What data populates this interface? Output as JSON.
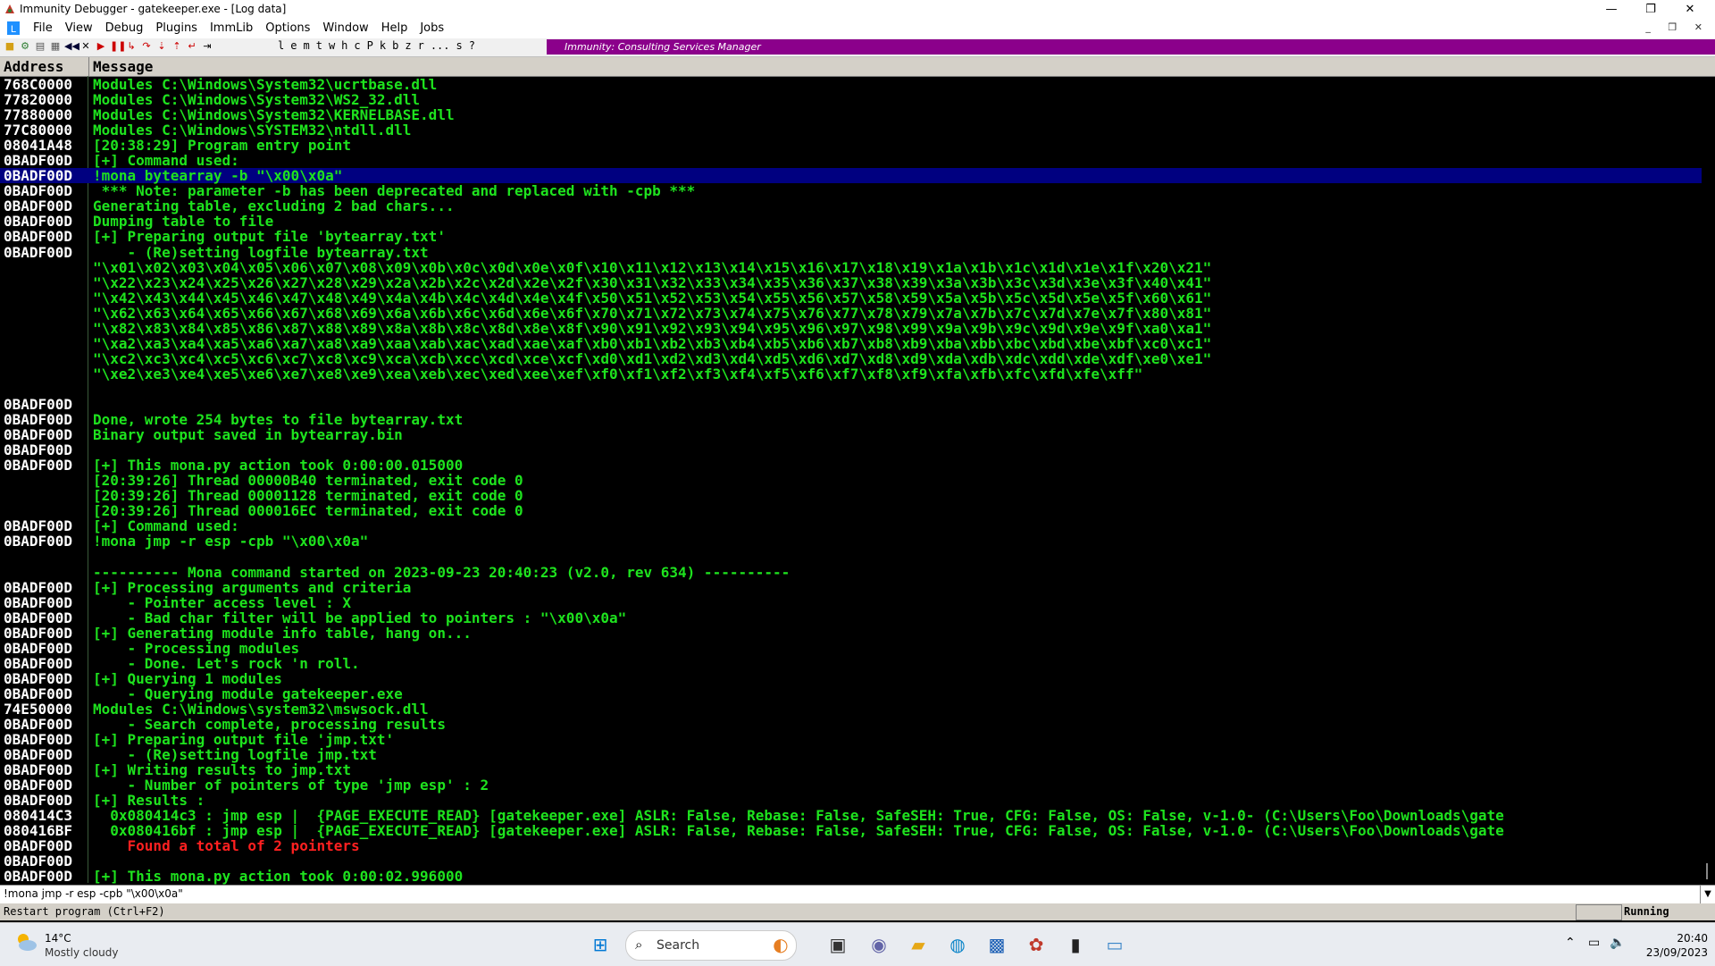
{
  "window": {
    "title": "Immunity Debugger - gatekeeper.exe - [Log data]",
    "controls": {
      "minimize": "—",
      "maximize": "❐",
      "close": "✕"
    }
  },
  "menu": [
    "File",
    "View",
    "Debug",
    "Plugins",
    "ImmLib",
    "Options",
    "Window",
    "Help",
    "Jobs"
  ],
  "toolbar": {
    "letters": [
      "l",
      "e",
      "m",
      "t",
      "w",
      "h",
      "c",
      "P",
      "k",
      "b",
      "z",
      "r",
      "...",
      "s",
      "?"
    ],
    "banner": "Immunity: Consulting Services Manager"
  },
  "log": {
    "headers": {
      "address": "Address",
      "message": "Message"
    },
    "rows": [
      {
        "a": "768C0000",
        "m": "Modules C:\\Windows\\System32\\ucrtbase.dll"
      },
      {
        "a": "77820000",
        "m": "Modules C:\\Windows\\System32\\WS2_32.dll"
      },
      {
        "a": "77880000",
        "m": "Modules C:\\Windows\\System32\\KERNELBASE.dll"
      },
      {
        "a": "77C80000",
        "m": "Modules C:\\Windows\\SYSTEM32\\ntdll.dll"
      },
      {
        "a": "08041A48",
        "m": "[20:38:29] Program entry point"
      },
      {
        "a": "0BADF00D",
        "m": "[+] Command used:"
      },
      {
        "a": "0BADF00D",
        "m": "!mona bytearray -b \"\\x00\\x0a\"",
        "sel": true
      },
      {
        "a": "0BADF00D",
        "m": " *** Note: parameter -b has been deprecated and replaced with -cpb ***"
      },
      {
        "a": "0BADF00D",
        "m": "Generating table, excluding 2 bad chars..."
      },
      {
        "a": "0BADF00D",
        "m": "Dumping table to file"
      },
      {
        "a": "0BADF00D",
        "m": "[+] Preparing output file 'bytearray.txt'"
      },
      {
        "a": "0BADF00D",
        "m": "    - (Re)setting logfile bytearray.txt"
      },
      {
        "a": "",
        "m": "\"\\x01\\x02\\x03\\x04\\x05\\x06\\x07\\x08\\x09\\x0b\\x0c\\x0d\\x0e\\x0f\\x10\\x11\\x12\\x13\\x14\\x15\\x16\\x17\\x18\\x19\\x1a\\x1b\\x1c\\x1d\\x1e\\x1f\\x20\\x21\""
      },
      {
        "a": "",
        "m": "\"\\x22\\x23\\x24\\x25\\x26\\x27\\x28\\x29\\x2a\\x2b\\x2c\\x2d\\x2e\\x2f\\x30\\x31\\x32\\x33\\x34\\x35\\x36\\x37\\x38\\x39\\x3a\\x3b\\x3c\\x3d\\x3e\\x3f\\x40\\x41\""
      },
      {
        "a": "",
        "m": "\"\\x42\\x43\\x44\\x45\\x46\\x47\\x48\\x49\\x4a\\x4b\\x4c\\x4d\\x4e\\x4f\\x50\\x51\\x52\\x53\\x54\\x55\\x56\\x57\\x58\\x59\\x5a\\x5b\\x5c\\x5d\\x5e\\x5f\\x60\\x61\""
      },
      {
        "a": "",
        "m": "\"\\x62\\x63\\x64\\x65\\x66\\x67\\x68\\x69\\x6a\\x6b\\x6c\\x6d\\x6e\\x6f\\x70\\x71\\x72\\x73\\x74\\x75\\x76\\x77\\x78\\x79\\x7a\\x7b\\x7c\\x7d\\x7e\\x7f\\x80\\x81\""
      },
      {
        "a": "",
        "m": "\"\\x82\\x83\\x84\\x85\\x86\\x87\\x88\\x89\\x8a\\x8b\\x8c\\x8d\\x8e\\x8f\\x90\\x91\\x92\\x93\\x94\\x95\\x96\\x97\\x98\\x99\\x9a\\x9b\\x9c\\x9d\\x9e\\x9f\\xa0\\xa1\""
      },
      {
        "a": "",
        "m": "\"\\xa2\\xa3\\xa4\\xa5\\xa6\\xa7\\xa8\\xa9\\xaa\\xab\\xac\\xad\\xae\\xaf\\xb0\\xb1\\xb2\\xb3\\xb4\\xb5\\xb6\\xb7\\xb8\\xb9\\xba\\xbb\\xbc\\xbd\\xbe\\xbf\\xc0\\xc1\""
      },
      {
        "a": "",
        "m": "\"\\xc2\\xc3\\xc4\\xc5\\xc6\\xc7\\xc8\\xc9\\xca\\xcb\\xcc\\xcd\\xce\\xcf\\xd0\\xd1\\xd2\\xd3\\xd4\\xd5\\xd6\\xd7\\xd8\\xd9\\xda\\xdb\\xdc\\xdd\\xde\\xdf\\xe0\\xe1\""
      },
      {
        "a": "",
        "m": "\"\\xe2\\xe3\\xe4\\xe5\\xe6\\xe7\\xe8\\xe9\\xea\\xeb\\xec\\xed\\xee\\xef\\xf0\\xf1\\xf2\\xf3\\xf4\\xf5\\xf6\\xf7\\xf8\\xf9\\xfa\\xfb\\xfc\\xfd\\xfe\\xff\""
      },
      {
        "a": "",
        "m": ""
      },
      {
        "a": "0BADF00D",
        "m": ""
      },
      {
        "a": "0BADF00D",
        "m": "Done, wrote 254 bytes to file bytearray.txt"
      },
      {
        "a": "0BADF00D",
        "m": "Binary output saved in bytearray.bin"
      },
      {
        "a": "0BADF00D",
        "m": ""
      },
      {
        "a": "0BADF00D",
        "m": "[+] This mona.py action took 0:00:00.015000"
      },
      {
        "a": "",
        "m": "[20:39:26] Thread 00000B40 terminated, exit code 0"
      },
      {
        "a": "",
        "m": "[20:39:26] Thread 00001128 terminated, exit code 0"
      },
      {
        "a": "",
        "m": "[20:39:26] Thread 000016EC terminated, exit code 0"
      },
      {
        "a": "0BADF00D",
        "m": "[+] Command used:"
      },
      {
        "a": "0BADF00D",
        "m": "!mona jmp -r esp -cpb \"\\x00\\x0a\""
      },
      {
        "a": "",
        "m": ""
      },
      {
        "a": "",
        "m": "---------- Mona command started on 2023-09-23 20:40:23 (v2.0, rev 634) ----------"
      },
      {
        "a": "0BADF00D",
        "m": "[+] Processing arguments and criteria"
      },
      {
        "a": "0BADF00D",
        "m": "    - Pointer access level : X"
      },
      {
        "a": "0BADF00D",
        "m": "    - Bad char filter will be applied to pointers : \"\\x00\\x0a\""
      },
      {
        "a": "0BADF00D",
        "m": "[+] Generating module info table, hang on..."
      },
      {
        "a": "0BADF00D",
        "m": "    - Processing modules"
      },
      {
        "a": "0BADF00D",
        "m": "    - Done. Let's rock 'n roll."
      },
      {
        "a": "0BADF00D",
        "m": "[+] Querying 1 modules"
      },
      {
        "a": "0BADF00D",
        "m": "    - Querying module gatekeeper.exe"
      },
      {
        "a": "74E50000",
        "m": "Modules C:\\Windows\\system32\\mswsock.dll"
      },
      {
        "a": "0BADF00D",
        "m": "    - Search complete, processing results"
      },
      {
        "a": "0BADF00D",
        "m": "[+] Preparing output file 'jmp.txt'"
      },
      {
        "a": "0BADF00D",
        "m": "    - (Re)setting logfile jmp.txt"
      },
      {
        "a": "0BADF00D",
        "m": "[+] Writing results to jmp.txt"
      },
      {
        "a": "0BADF00D",
        "m": "    - Number of pointers of type 'jmp esp' : 2"
      },
      {
        "a": "0BADF00D",
        "m": "[+] Results :"
      },
      {
        "a": "080414C3",
        "m": "  0x080414c3 : jmp esp |  {PAGE_EXECUTE_READ} [gatekeeper.exe] ASLR: False, Rebase: False, SafeSEH: True, CFG: False, OS: False, v-1.0- (C:\\Users\\Foo\\Downloads\\gate"
      },
      {
        "a": "080416BF",
        "m": "  0x080416bf : jmp esp |  {PAGE_EXECUTE_READ} [gatekeeper.exe] ASLR: False, Rebase: False, SafeSEH: True, CFG: False, OS: False, v-1.0- (C:\\Users\\Foo\\Downloads\\gate"
      },
      {
        "a": "0BADF00D",
        "m": "    Found a total of 2 pointers",
        "red": true
      },
      {
        "a": "0BADF00D",
        "m": ""
      },
      {
        "a": "0BADF00D",
        "m": "[+] This mona.py action took 0:00:02.996000"
      }
    ]
  },
  "command_input": "!mona jmp -r esp -cpb \"\\x00\\x0a\"",
  "status": {
    "hint": "Restart program (Ctrl+F2)",
    "state": "Running"
  },
  "taskbar": {
    "weather_temp": "14°C",
    "weather_cond": "Mostly cloudy",
    "search_label": "Search",
    "time": "20:40",
    "date": "23/09/2023"
  }
}
